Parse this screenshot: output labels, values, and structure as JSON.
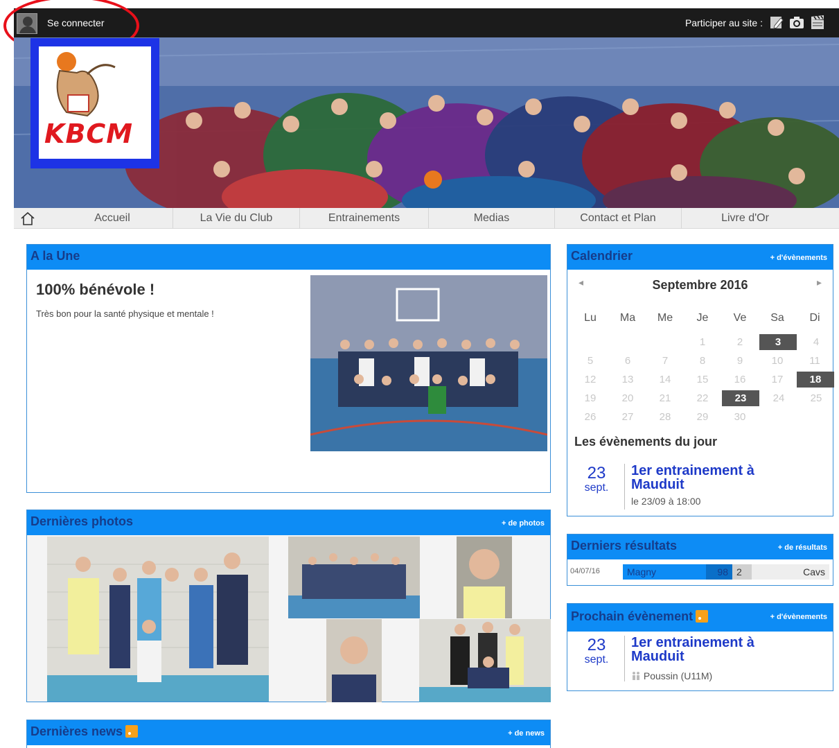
{
  "topbar": {
    "login_label": "Se connecter",
    "participate_label": "Participer au site :",
    "icons": [
      "pencil-icon",
      "camera-icon",
      "clapperboard-icon"
    ]
  },
  "banner": {
    "logo_text": "KBCM"
  },
  "nav": {
    "items": [
      "Accueil",
      "La Vie du Club",
      "Entrainements",
      "Medias",
      "Contact et Plan",
      "Livre d'Or"
    ]
  },
  "une": {
    "section_title": "A la Une",
    "title": "100% bénévole !",
    "text": "Très bon pour la santé physique et mentale !"
  },
  "photos": {
    "section_title": "Dernières photos",
    "more": "+ de photos"
  },
  "news": {
    "section_title": "Dernières news",
    "more": "+ de news"
  },
  "calendar": {
    "section_title": "Calendrier",
    "more": "+ d'évènements",
    "prev": "◂",
    "next": "▸",
    "month": "Septembre 2016",
    "weekdays": [
      "Lu",
      "Ma",
      "Me",
      "Je",
      "Ve",
      "Sa",
      "Di"
    ],
    "weeks": [
      [
        "",
        "",
        "",
        "1",
        "2",
        "3",
        "4"
      ],
      [
        "5",
        "6",
        "7",
        "8",
        "9",
        "10",
        "11"
      ],
      [
        "12",
        "13",
        "14",
        "15",
        "16",
        "17",
        "18"
      ],
      [
        "19",
        "20",
        "21",
        "22",
        "23",
        "24",
        "25"
      ],
      [
        "26",
        "27",
        "28",
        "29",
        "30",
        "",
        ""
      ]
    ],
    "event_days": [
      "3",
      "18",
      "23"
    ],
    "today_title": "Les évènements du jour",
    "event": {
      "day": "23",
      "month": "sept.",
      "title": "1er entrainement à Mauduit",
      "when": "le 23/09 à 18:00"
    }
  },
  "results": {
    "section_title": "Derniers résultats",
    "more": "+ de résultats",
    "row": {
      "date": "04/07/16",
      "home": "Magny",
      "home_score": "98",
      "away_score": "2",
      "away": "Cavs"
    }
  },
  "next_event": {
    "section_title": "Prochain évènement",
    "more": "+ d'évènements",
    "day": "23",
    "month": "sept.",
    "title": "1er entrainement à Mauduit",
    "team": "Poussin (U11M)"
  }
}
